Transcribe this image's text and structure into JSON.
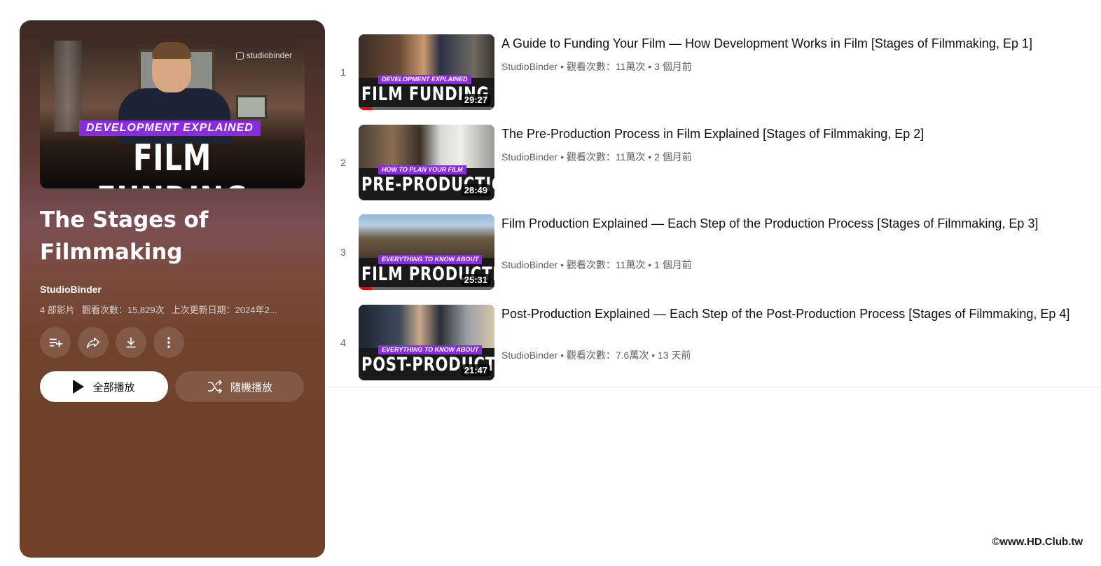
{
  "playlist": {
    "hero_brand": "studiobinder",
    "hero_tag": "DEVELOPMENT EXPLAINED",
    "hero_title": "FILM FUNDING",
    "title": "The Stages of Filmmaking",
    "channel": "StudioBinder",
    "video_count": "4 部影片",
    "views": "觀看次數：15,829次",
    "updated": "上次更新日期：2024年2...",
    "play_all_label": "全部播放",
    "shuffle_label": "隨機播放",
    "icons": [
      "add-to-queue-icon",
      "share-icon",
      "download-icon",
      "more-vert-icon"
    ]
  },
  "videos": [
    {
      "index": "1",
      "title": "A Guide to Funding Your Film — How Development Works in Film [Stages of Filmmaking, Ep 1]",
      "channel": "StudioBinder",
      "stats": "觀看次數：11萬次 • 3 個月前",
      "thumb_tag": "DEVELOPMENT EXPLAINED",
      "thumb_title": "FILM FUNDING",
      "duration": "29:27",
      "watched_fraction": 0.1
    },
    {
      "index": "2",
      "title": "The Pre-Production Process in Film Explained [Stages of Filmmaking, Ep 2]",
      "channel": "StudioBinder",
      "stats": "觀看次數：11萬次 • 2 個月前",
      "thumb_tag": "HOW TO PLAN YOUR FILM",
      "thumb_title": "PRE-PRODUCTION",
      "duration": "28:49",
      "watched_fraction": 0
    },
    {
      "index": "3",
      "title": "Film Production Explained — Each Step of the Production Process [Stages of Filmmaking, Ep 3]",
      "channel": "StudioBinder",
      "stats": "觀看次數：11萬次 • 1 個月前",
      "thumb_tag": "EVERYTHING TO KNOW ABOUT",
      "thumb_title": "FILM PRODUCTION",
      "duration": "25:31",
      "watched_fraction": 0.1
    },
    {
      "index": "4",
      "title": "Post-Production Explained — Each Step of the Post-Production Process [Stages of Filmmaking, Ep 4]",
      "channel": "StudioBinder",
      "stats": "觀看次數：7.6萬次 • 13 天前",
      "thumb_tag": "EVERYTHING TO KNOW ABOUT",
      "thumb_title": "POST-PRODUCTION",
      "duration": "21:47",
      "watched_fraction": 0
    }
  ],
  "watermark": "©www.HD.Club.tw",
  "colors": {
    "panel": "#6f3f28",
    "accent_tag": "#8a2be2",
    "progress": "#ff0000"
  }
}
